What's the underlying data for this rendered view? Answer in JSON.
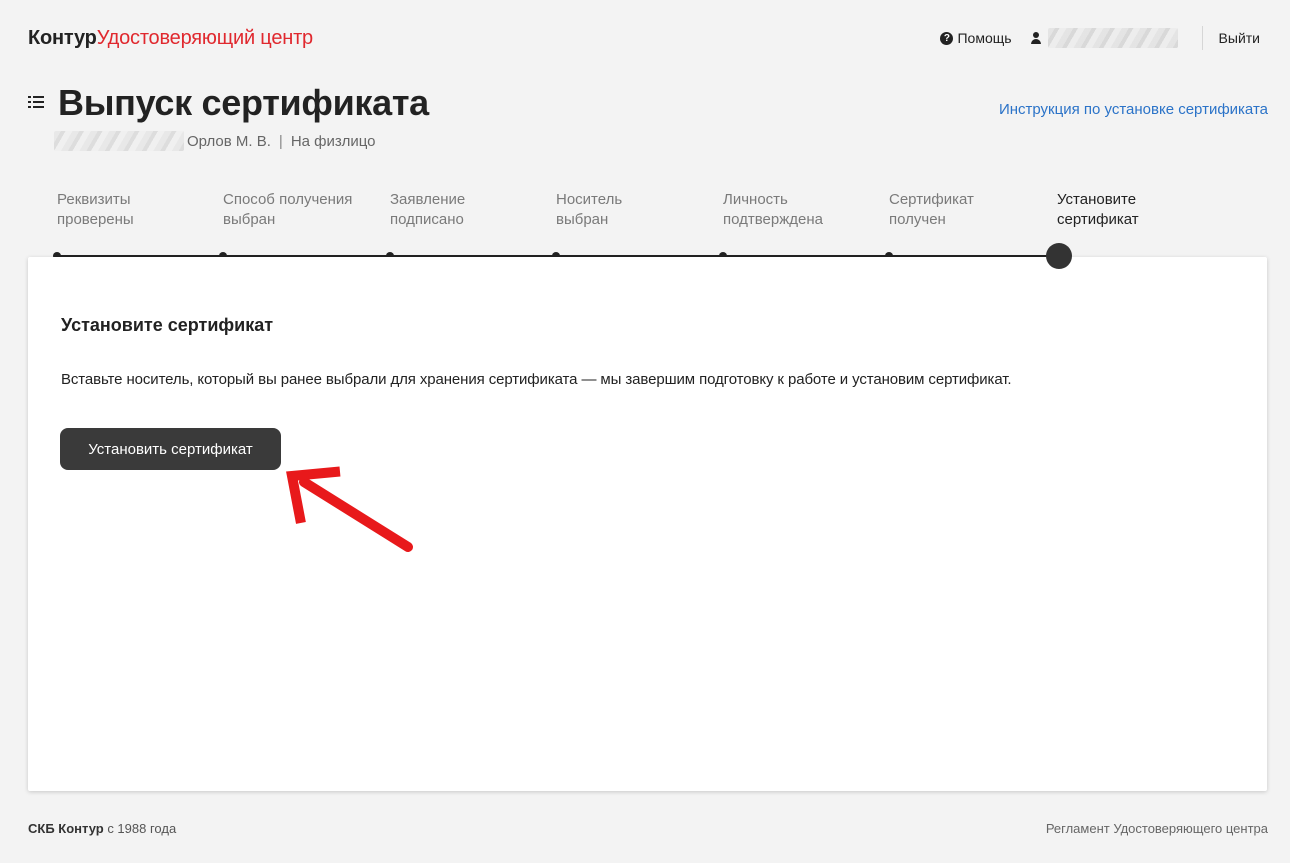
{
  "header": {
    "logo_brand": "Контур",
    "logo_product": "Удостоверяющий центр",
    "help_label": "Помощь",
    "logout_label": "Выйти"
  },
  "title": {
    "heading": "Выпуск сертификата",
    "person": "Орлов М. В.",
    "separator": "|",
    "cert_type": "На физлицо",
    "install_instruction_link": "Инструкция по установке сертификата"
  },
  "stepper": {
    "steps": [
      {
        "line1": "Реквизиты",
        "line2": "проверены",
        "state": "done"
      },
      {
        "line1": "Способ получения",
        "line2": "выбран",
        "state": "done"
      },
      {
        "line1": "Заявление",
        "line2": "подписано",
        "state": "done"
      },
      {
        "line1": "Носитель",
        "line2": "выбран",
        "state": "done"
      },
      {
        "line1": "Личность",
        "line2": "подтверждена",
        "state": "done"
      },
      {
        "line1": "Сертификат",
        "line2": "получен",
        "state": "done"
      },
      {
        "line1": "Установите",
        "line2": "сертификат",
        "state": "current"
      }
    ]
  },
  "card": {
    "title": "Установите сертификат",
    "text": "Вставьте носитель, который вы ранее выбрали для хранения сертификата — мы завершим подготовку к работе и установим сертификат.",
    "button_label": "Установить сертификат"
  },
  "footer": {
    "company": "СКБ Контур",
    "since": " с 1988 года",
    "regulation_link": "Регламент Удостоверяющего центра"
  },
  "colors": {
    "brand_red": "#e0282e",
    "link_blue": "#2b73c8",
    "button_dark": "#3a3a3a",
    "annotation_arrow": "#e8191b"
  },
  "icons": [
    "help-icon",
    "user-icon",
    "menu-icon",
    "annotation-arrow-icon"
  ]
}
